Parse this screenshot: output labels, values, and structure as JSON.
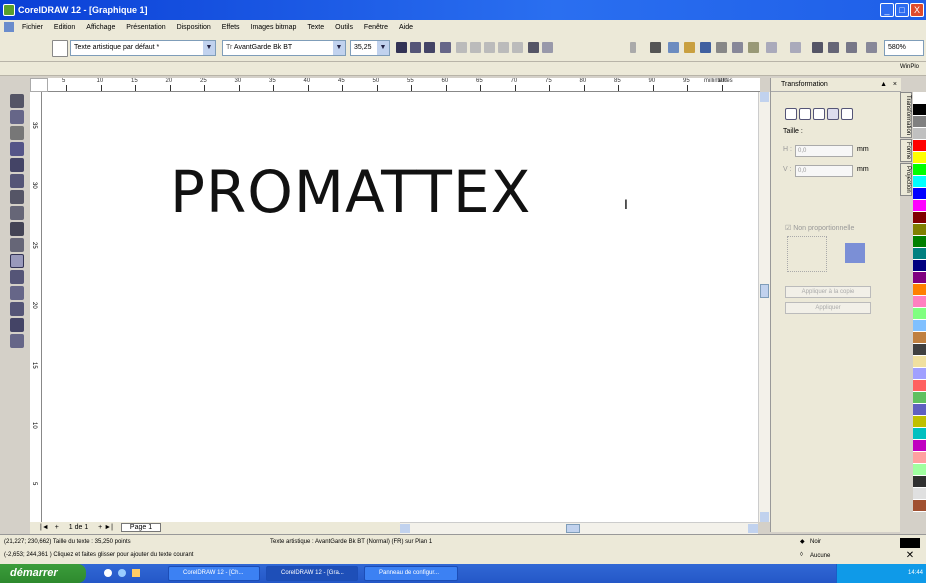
{
  "window": {
    "title": "CorelDRAW 12 - [Graphique 1]",
    "min": "_",
    "max": "□",
    "close": "X"
  },
  "menu": [
    "Fichier",
    "Edition",
    "Affichage",
    "Présentation",
    "Disposition",
    "Effets",
    "Images bitmap",
    "Texte",
    "Outils",
    "Fenêtre",
    "Aide"
  ],
  "toolbar": {
    "style_combo": "Texte artistique par défaut *",
    "font_combo": "AvantGarde Bk BT",
    "size_combo": "35,25",
    "zoom_combo": "580%",
    "workspace": "WinPlo"
  },
  "ruler": {
    "unit": "millimètres",
    "top_labels": [
      "5",
      "10",
      "15",
      "20",
      "25",
      "30",
      "35",
      "40",
      "45",
      "50",
      "55",
      "60",
      "65",
      "70",
      "75",
      "80",
      "85",
      "90",
      "95",
      "100"
    ],
    "left_labels": [
      "35",
      "30",
      "25",
      "20",
      "15",
      "10",
      "5"
    ]
  },
  "canvas": {
    "text": "PROMATTEX"
  },
  "pagebar": {
    "count": "1 de 1",
    "page_tab": "Page 1"
  },
  "docker": {
    "title": "Transformation",
    "size_label": "Taille :",
    "h_label": "H :",
    "h_value": "0,0",
    "v_label": "V :",
    "v_value": "0,0",
    "unit": "mm",
    "checkbox": "Non proportionnelle",
    "apply_copy": "Appliquer à la copie",
    "apply": "Appliquer"
  },
  "side_tabs": [
    "Transformation",
    "Forme",
    "Projection"
  ],
  "palette_colors": [
    "#ffffff",
    "#000000",
    "#808080",
    "#c0c0c0",
    "#ff0000",
    "#ffff00",
    "#00ff00",
    "#00ffff",
    "#0000ff",
    "#ff00ff",
    "#800000",
    "#808000",
    "#008000",
    "#008080",
    "#000080",
    "#800080",
    "#ff8000",
    "#ff80c0",
    "#80ff80",
    "#80c0ff",
    "#c08040",
    "#404040",
    "#f0e0a0",
    "#a0a0ff",
    "#ff6060",
    "#60c060",
    "#6060c0",
    "#c0c000",
    "#00c0c0",
    "#c000c0",
    "#ffa0a0",
    "#a0ffa0",
    "#303030",
    "#e0e0e0",
    "#a05030"
  ],
  "status": {
    "line1_left": "(21,227; 230,662) Taille du texte : 35,250 points",
    "line1_mid": "Texte artistique : AvantGarde Bk BT (Normal) (FR) sur Plan 1",
    "line2_left": "(-2,653; 244,361 )    Cliquez et faites glisser pour ajouter du texte courant",
    "fill_label": "Noir",
    "outline_label": "Aucune"
  },
  "taskbar": {
    "start": "démarrer",
    "tasks": [
      "CorelDRAW 12 - [Ch...",
      "CorelDRAW 12 - [Gra...",
      "Panneau de configur..."
    ],
    "clock": "14:44"
  }
}
